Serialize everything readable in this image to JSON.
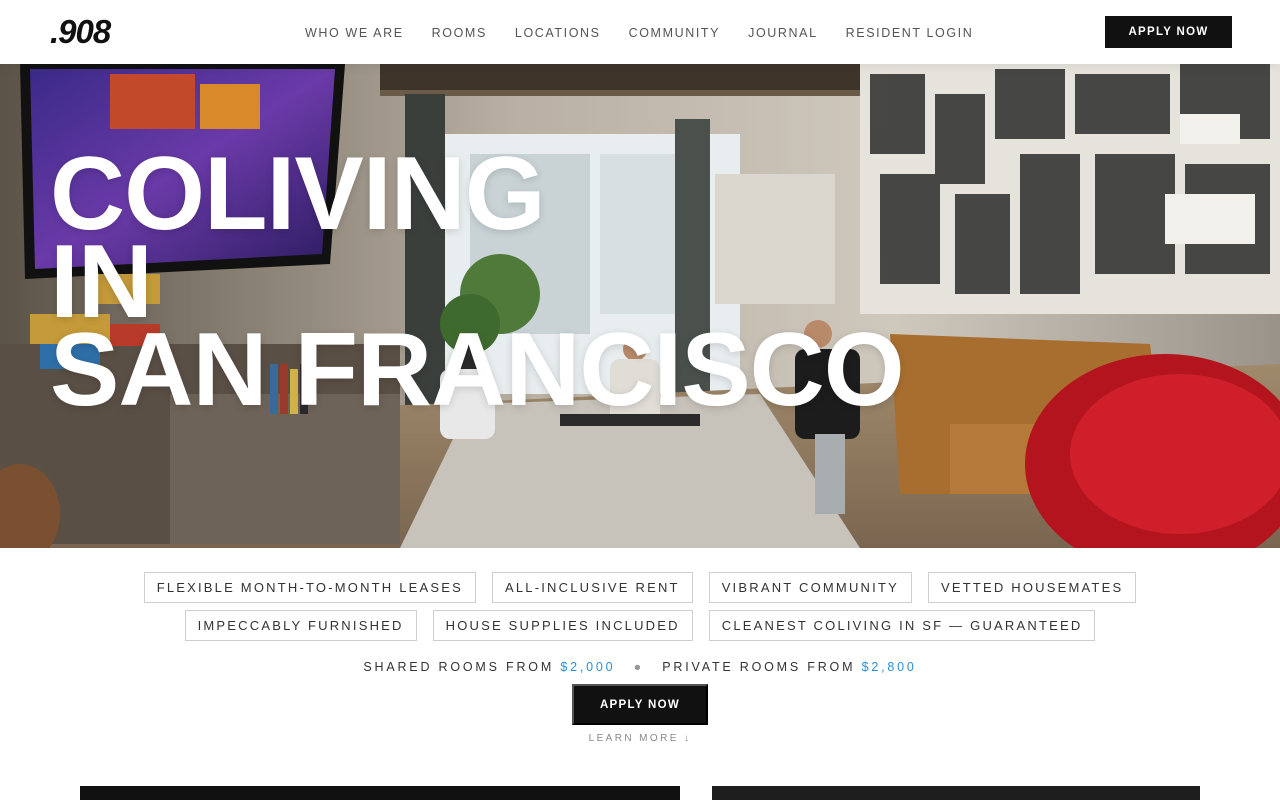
{
  "header": {
    "logo": ".908",
    "nav": [
      "WHO WE ARE",
      "ROOMS",
      "LOCATIONS",
      "COMMUNITY",
      "JOURNAL",
      "RESIDENT LOGIN"
    ],
    "apply_label": "APPLY NOW"
  },
  "hero": {
    "title_lines": [
      "COLIVING",
      "IN",
      "SAN FRANCISCO"
    ]
  },
  "features": {
    "row1": [
      "FLEXIBLE MONTH-TO-MONTH LEASES",
      "ALL-INCLUSIVE RENT",
      "VIBRANT COMMUNITY",
      "VETTED HOUSEMATES"
    ],
    "row2": [
      "IMPECCABLY FURNISHED",
      "HOUSE SUPPLIES INCLUDED",
      "CLEANEST COLIVING IN SF — GUARANTEED"
    ]
  },
  "pricing": {
    "shared_label": "SHARED ROOMS FROM",
    "shared_price": "$2,000",
    "separator": "●",
    "private_label": "PRIVATE ROOMS FROM",
    "private_price": "$2,800",
    "price_color": "#2a8fd6"
  },
  "cta": {
    "apply_label": "APPLY NOW",
    "learn_more": "LEARN MORE ↓"
  }
}
